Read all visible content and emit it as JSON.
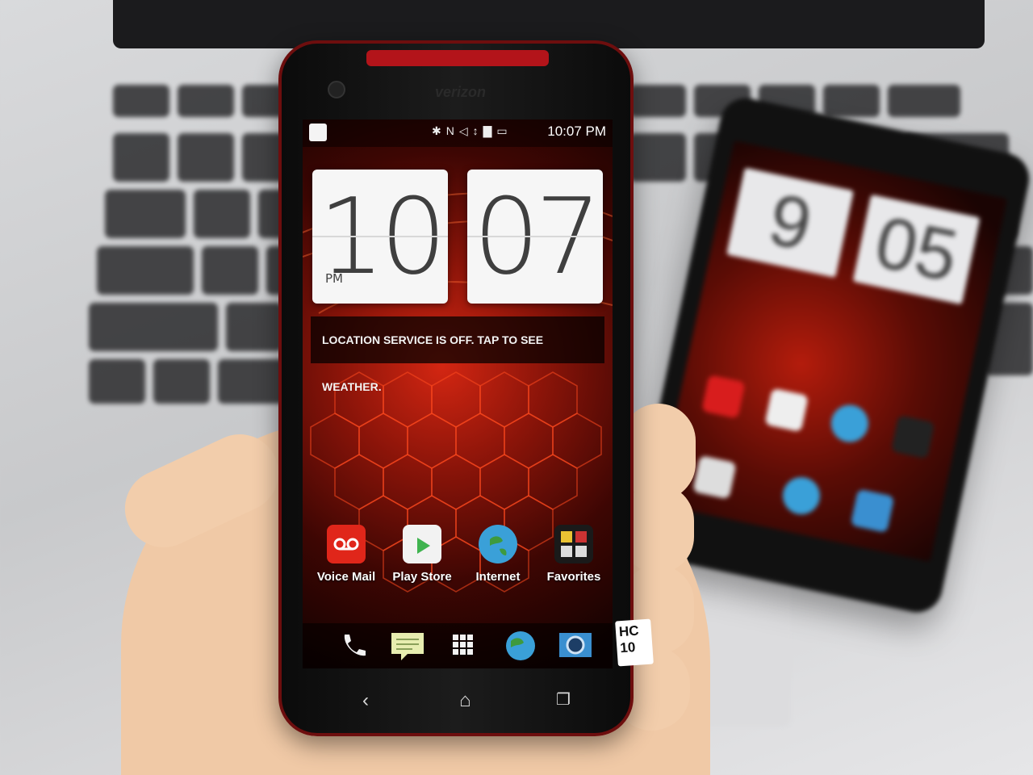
{
  "phone": {
    "brand": "verizon",
    "status_bar": {
      "icons": [
        "bluetooth-icon",
        "nfc-icon",
        "mute-icon",
        "data-icon",
        "signal-icon",
        "battery-icon"
      ],
      "time": "10:07 PM"
    },
    "clock_widget": {
      "hours": "10",
      "minutes": "07",
      "ampm": "PM"
    },
    "weather_widget": {
      "message": "LOCATION SERVICE IS OFF. TAP TO SEE WEATHER."
    },
    "home_apps": [
      {
        "label": "Voice Mail",
        "icon": "voicemail-icon",
        "color": "#e0261a"
      },
      {
        "label": "Play Store",
        "icon": "play-store-icon",
        "color": "#f2f2f2"
      },
      {
        "label": "Internet",
        "icon": "globe-icon",
        "color": "#3aa0d8"
      },
      {
        "label": "Favorites",
        "icon": "favorites-folder-icon",
        "color": "#1a1a1a"
      }
    ],
    "dock": [
      "phone-icon",
      "messages-icon",
      "app-drawer-icon",
      "browser-icon",
      "camera-icon"
    ],
    "nav": [
      "back-icon",
      "home-icon",
      "recent-apps-icon"
    ],
    "sticker_text": "HC 10"
  },
  "accent_colors": {
    "phone_red": "#b3141a",
    "screen_red": "#d32612"
  }
}
